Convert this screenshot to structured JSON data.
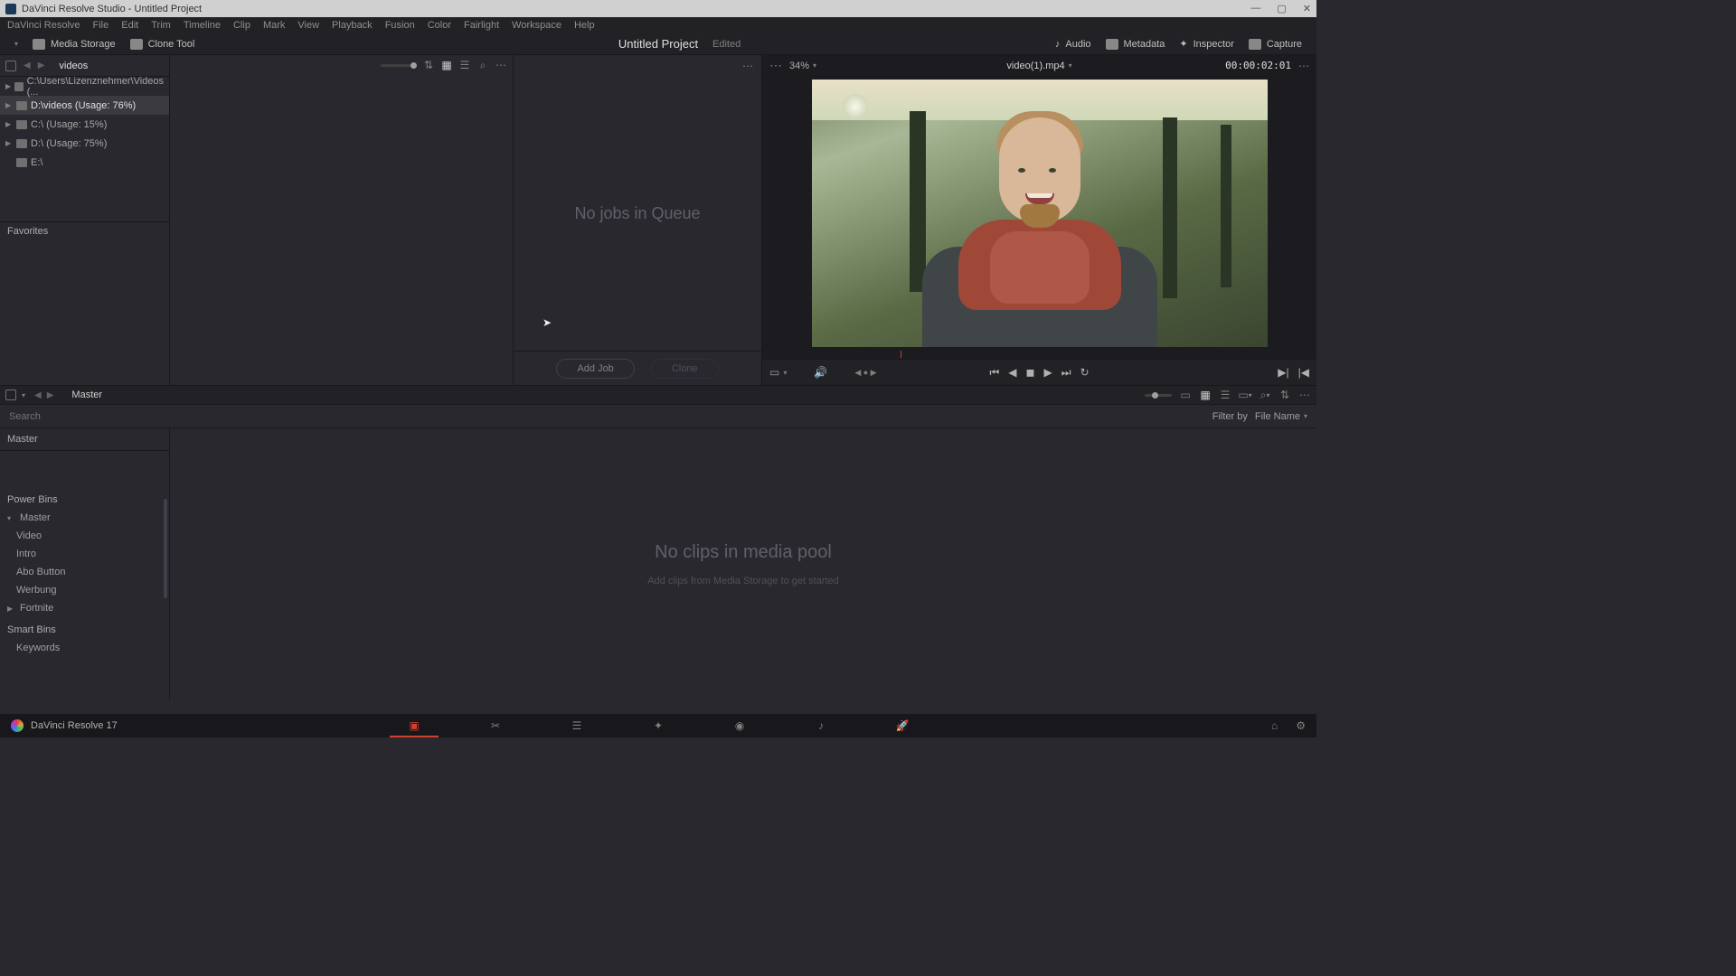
{
  "titlebar": {
    "text": "DaVinci Resolve Studio - Untitled Project"
  },
  "menu": [
    "DaVinci Resolve",
    "File",
    "Edit",
    "Trim",
    "Timeline",
    "Clip",
    "Mark",
    "View",
    "Playback",
    "Fusion",
    "Color",
    "Fairlight",
    "Workspace",
    "Help"
  ],
  "toolbar": {
    "media_storage": "Media Storage",
    "clone_tool": "Clone Tool",
    "project": "Untitled Project",
    "status": "Edited",
    "audio": "Audio",
    "metadata": "Metadata",
    "inspector": "Inspector",
    "capture": "Capture"
  },
  "storage": {
    "path": "videos",
    "items": [
      {
        "label": "C:\\Users\\Lizenznehmer\\Videos (...",
        "active": false
      },
      {
        "label": "D:\\videos (Usage: 76%)",
        "active": true
      },
      {
        "label": "C:\\ (Usage: 15%)",
        "active": false
      },
      {
        "label": "D:\\ (Usage: 75%)",
        "active": false
      },
      {
        "label": "E:\\",
        "active": false
      }
    ],
    "favorites": "Favorites"
  },
  "clone": {
    "empty": "No jobs in Queue",
    "add": "Add Job",
    "clone": "Clone"
  },
  "viewer": {
    "zoom": "34%",
    "filename": "video(1).mp4",
    "timecode": "00:00:02:01"
  },
  "pool": {
    "crumb": "Master",
    "search_placeholder": "Search",
    "filter_by": "Filter by",
    "filter_value": "File Name",
    "master": "Master",
    "power_bins": "Power Bins",
    "bins": [
      "Master",
      "Video",
      "Intro",
      "Abo Button",
      "Werbung",
      "Fortnite"
    ],
    "smart_bins": "Smart Bins",
    "keywords": "Keywords",
    "empty1": "No clips in media pool",
    "empty2": "Add clips from Media Storage to get started"
  },
  "brand": "DaVinci Resolve 17"
}
